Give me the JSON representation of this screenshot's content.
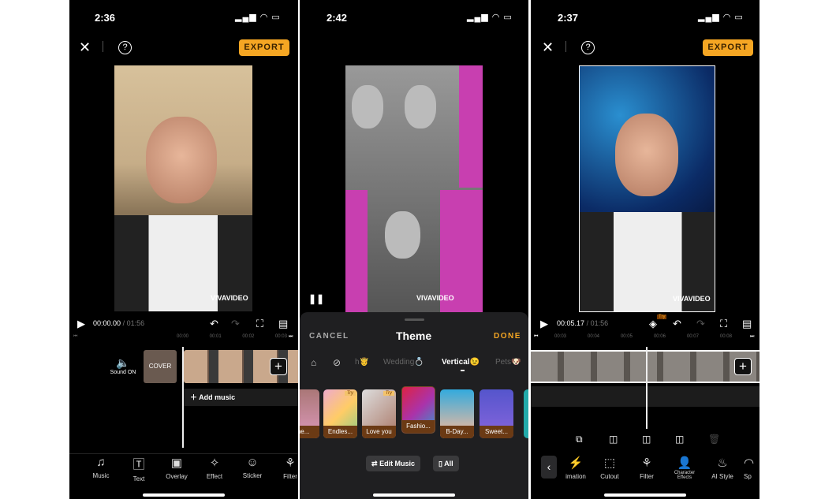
{
  "colors": {
    "accent": "#f5a623",
    "background": "#000000",
    "sheet": "#1f1f21"
  },
  "panel1": {
    "status_time": "2:36",
    "export_label": "EXPORT",
    "close_icon": "close-icon",
    "help_label": "?",
    "current_time": "00:00.00",
    "total_time": "/ 01:56",
    "ruler": [
      "00:00",
      "00:01",
      "00:02",
      "00:03"
    ],
    "sound_label": "Sound ON",
    "cover_label": "COVER",
    "add_music_label": "Add music",
    "watermark": "VIVAVIDEO",
    "toolbar": [
      {
        "icon": "music-note-icon",
        "label": "Music"
      },
      {
        "icon": "text-icon",
        "label": "Text"
      },
      {
        "icon": "overlay-icon",
        "label": "Overlay"
      },
      {
        "icon": "sparkle-icon",
        "label": "Effect"
      },
      {
        "icon": "sticker-icon",
        "label": "Sticker"
      },
      {
        "icon": "filter-icon",
        "label": "Filter"
      }
    ]
  },
  "panel2": {
    "status_time": "2:42",
    "watermark": "VIVAVIDEO",
    "cancel_label": "CANCEL",
    "title": "Theme",
    "done_label": "DONE",
    "categories": [
      "h🤴",
      "Wedding💍",
      "Vertical😉",
      "Pets🐶"
    ],
    "active_category": "Vertical😉",
    "themes": [
      {
        "label": "me...",
        "try": false
      },
      {
        "label": "Endles...",
        "try": true
      },
      {
        "label": "Love you",
        "try": true
      },
      {
        "label": "Fashio...",
        "try": false,
        "selected": true
      },
      {
        "label": "B-Day...",
        "try": false
      },
      {
        "label": "Sweet...",
        "try": false
      }
    ],
    "try_label": "Try",
    "edit_music_label": "Edit Music",
    "all_label": "All"
  },
  "panel3": {
    "status_time": "2:37",
    "export_label": "EXPORT",
    "help_label": "?",
    "try_badge": "Try",
    "current_time": "00:05.17",
    "total_time": "/ 01:56",
    "ruler": [
      "00:03",
      "00:04",
      "00:05",
      "00:06",
      "00:07",
      "00:08"
    ],
    "watermark": "VIVAVIDEO",
    "toolbar": [
      {
        "icon": "animation-icon",
        "label": "imation"
      },
      {
        "icon": "cutout-icon",
        "label": "Cutout"
      },
      {
        "icon": "filter-icon",
        "label": "Filter"
      },
      {
        "icon": "character-effects-icon",
        "label": "Character Effects"
      },
      {
        "icon": "ai-style-icon",
        "label": "AI Style"
      },
      {
        "icon": "speed-icon",
        "label": "Sp"
      }
    ]
  }
}
